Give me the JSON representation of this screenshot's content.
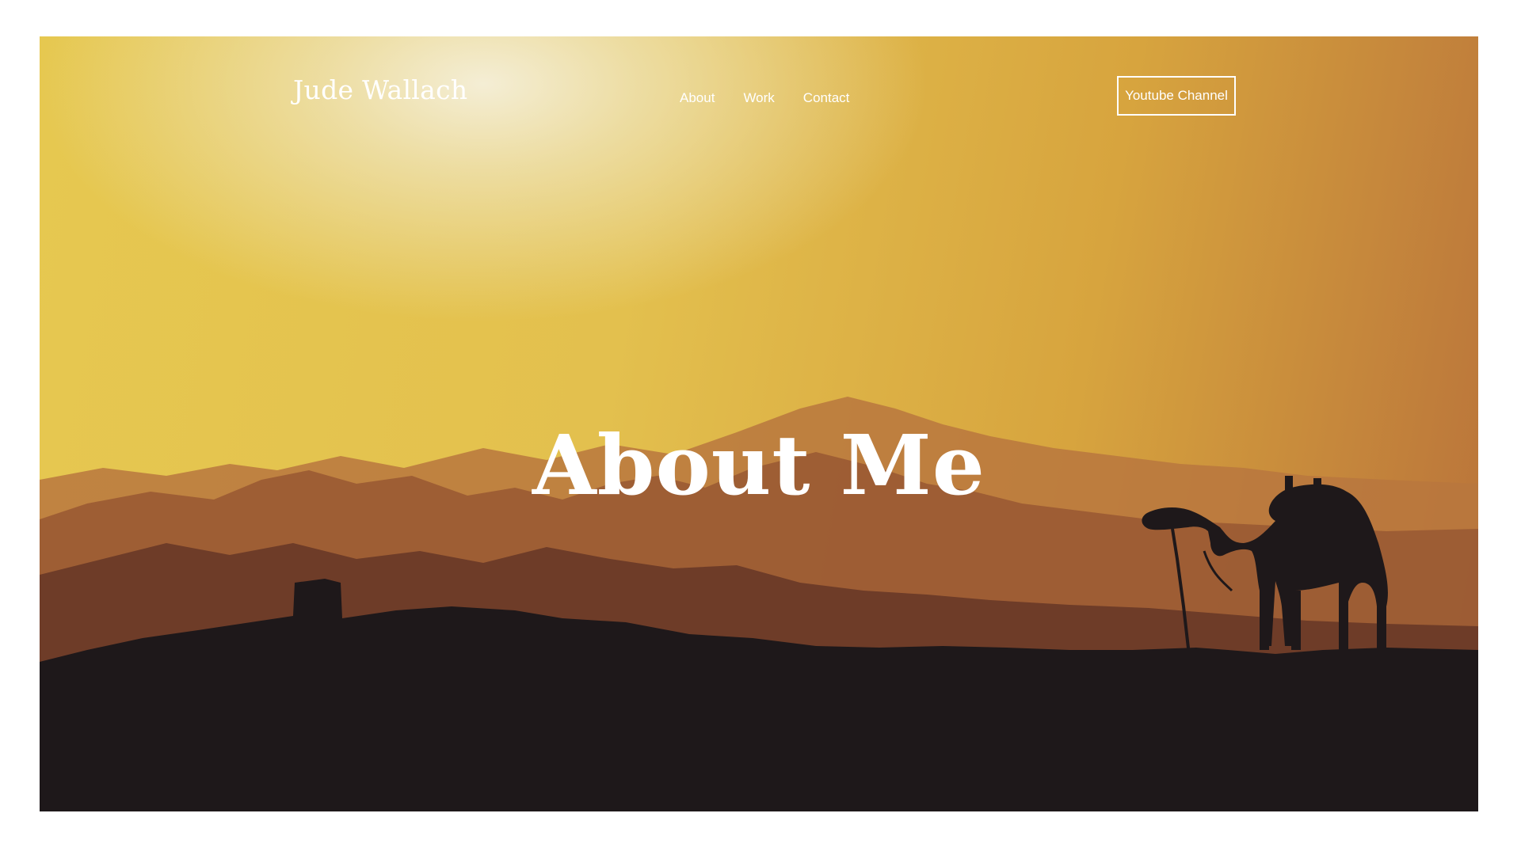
{
  "header": {
    "logo_text": "Jude Wallach",
    "nav": [
      {
        "label": "About"
      },
      {
        "label": "Work"
      },
      {
        "label": "Contact"
      }
    ],
    "cta_label": "Youtube Channel"
  },
  "hero": {
    "title": "About Me",
    "background_image": "desert-sunset-camel-silhouette",
    "colors": {
      "sky_light": "#f5f0dc",
      "sky_gold": "#e3c04e",
      "sky_orange": "#b8713a",
      "foreground": "#1e181a"
    }
  }
}
